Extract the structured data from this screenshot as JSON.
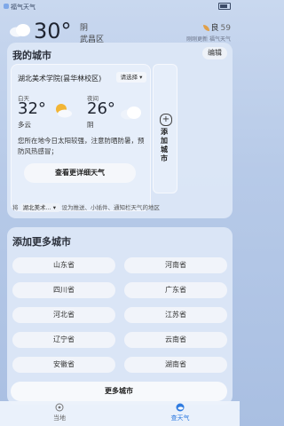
{
  "status_bar": {
    "app_name": "福气天气"
  },
  "top": {
    "temp": "30°",
    "condition": "阴",
    "area": "武昌区",
    "aqi_label": "良",
    "aqi_value": "59",
    "updated": "刚刚更新 福气天气"
  },
  "my_cities": {
    "title": "我的城市",
    "edit": "编辑",
    "city": {
      "name": "湖北美术学院(昙华林校区)",
      "select": "请选择",
      "day_label": "白天",
      "day_temp": "32°",
      "day_cond": "多云",
      "night_label": "夜间",
      "night_temp": "26°",
      "night_cond": "阴",
      "notice": "您所在地今日太阳较强，注意防晒防暑，预防风热感冒；",
      "detail_button": "查看更详细天气"
    },
    "add_city": "添加城市",
    "widget": {
      "prefix": "将",
      "selected": "湖北美术...",
      "suffix": "设为推送、小插件、通知栏天气的地区"
    }
  },
  "more_cities": {
    "title": "添加更多城市",
    "provinces": [
      "山东省",
      "河南省",
      "四川省",
      "广东省",
      "河北省",
      "江苏省",
      "辽宁省",
      "云南省",
      "安徽省",
      "湖南省"
    ],
    "more_button": "更多城市"
  },
  "nav": {
    "items": [
      {
        "label": "当地",
        "icon": "location-icon"
      },
      {
        "label": "查天气",
        "icon": "weather-icon"
      }
    ]
  },
  "colors": {
    "accent": "#2f7be0",
    "sun": "#f2b535"
  }
}
